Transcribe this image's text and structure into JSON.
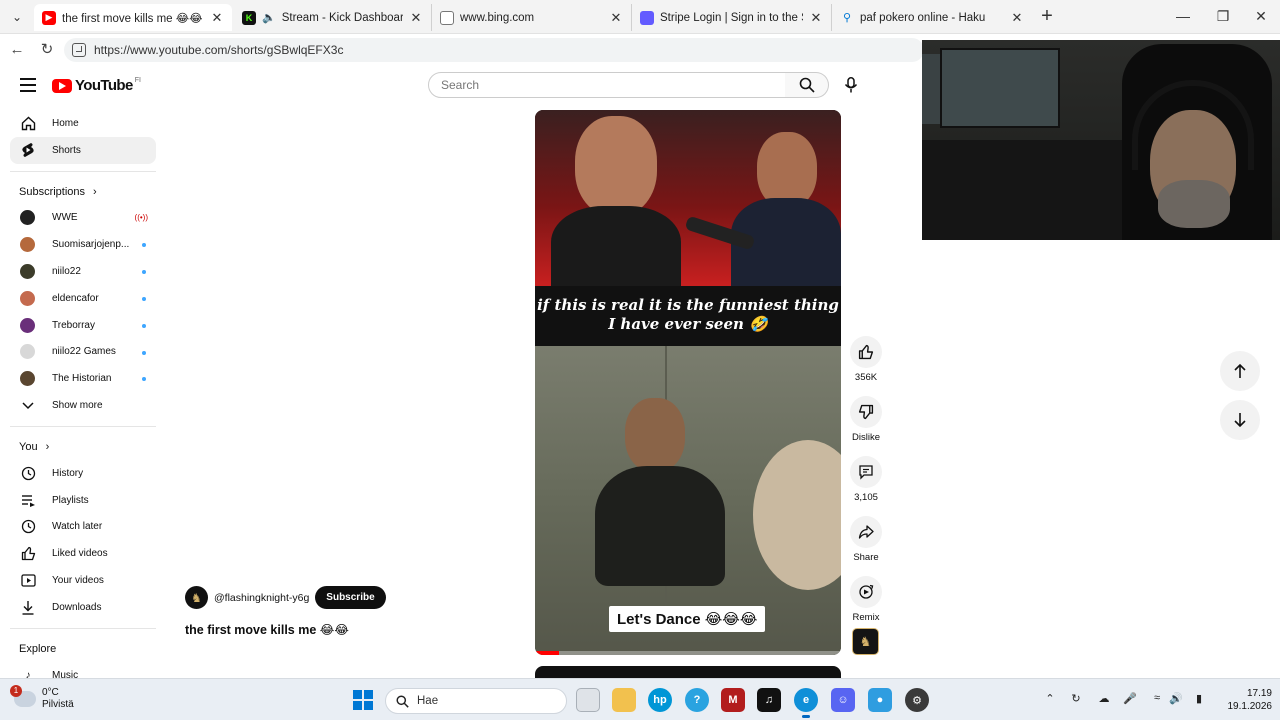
{
  "browser": {
    "tabs": [
      {
        "title": "the first move kills me 😂😂 - YouTube",
        "favicon": "youtube-icon",
        "active": true
      },
      {
        "title": "Stream - Kick Dashboard",
        "favicon": "kick-icon",
        "muted": true
      },
      {
        "title": "www.bing.com",
        "favicon": "page-icon"
      },
      {
        "title": "Stripe Login | Sign in to the Stripe",
        "favicon": "stripe-icon"
      },
      {
        "title": "paf pokero online - Haku",
        "favicon": "search-icon"
      }
    ],
    "url": "https://www.youtube.com/shorts/gSBwlqEFX3c"
  },
  "youtube": {
    "logo_text": "YouTube",
    "region": "FI",
    "search_placeholder": "Search",
    "nav": [
      {
        "label": "Home",
        "icon": "home-icon"
      },
      {
        "label": "Shorts",
        "icon": "shorts-icon",
        "active": true
      }
    ],
    "subscriptions_title": "Subscriptions",
    "subscriptions": [
      {
        "label": "WWE",
        "color": "#222222",
        "live": true
      },
      {
        "label": "Suomisarjojenp...",
        "color": "#b5693c"
      },
      {
        "label": "niilo22",
        "color": "#3c3c2a"
      },
      {
        "label": "eldencafor",
        "color": "#c46a4e"
      },
      {
        "label": "Treborray",
        "color": "#6a2f7a"
      },
      {
        "label": "niilo22 Games",
        "color": "#d8d8d8"
      },
      {
        "label": "The Historian",
        "color": "#5a4630"
      }
    ],
    "show_more": "Show more",
    "you_title": "You",
    "you_items": [
      {
        "label": "History",
        "icon": "history-icon"
      },
      {
        "label": "Playlists",
        "icon": "playlists-icon"
      },
      {
        "label": "Watch later",
        "icon": "watch-later-icon"
      },
      {
        "label": "Liked videos",
        "icon": "liked-videos-icon"
      },
      {
        "label": "Your videos",
        "icon": "your-videos-icon"
      },
      {
        "label": "Downloads",
        "icon": "downloads-icon"
      }
    ],
    "explore_title": "Explore",
    "explore_items": [
      {
        "label": "Music",
        "icon": "music-icon"
      }
    ],
    "short": {
      "overlay_text": [
        "if this is real it is the funniest thing",
        "I have ever seen 🤣"
      ],
      "caption": "Let's Dance 😂😂😂",
      "progress": 0.08
    },
    "channel": "@flashingknight-y6g",
    "subscribe_label": "Subscribe",
    "video_title": "the first move kills me 😂😂",
    "actions": [
      {
        "label": "356K",
        "icon": "like-icon"
      },
      {
        "label": "Dislike",
        "icon": "dislike-icon"
      },
      {
        "label": "3,105",
        "icon": "comment-icon"
      },
      {
        "label": "Share",
        "icon": "share-icon"
      },
      {
        "label": "Remix",
        "icon": "remix-icon"
      }
    ]
  },
  "taskbar": {
    "weather_temp": "0°C",
    "weather_desc": "Pilvistä",
    "weather_badge": "1",
    "search_placeholder": "Hae",
    "time": "17.19",
    "date": "19.1.2026"
  }
}
